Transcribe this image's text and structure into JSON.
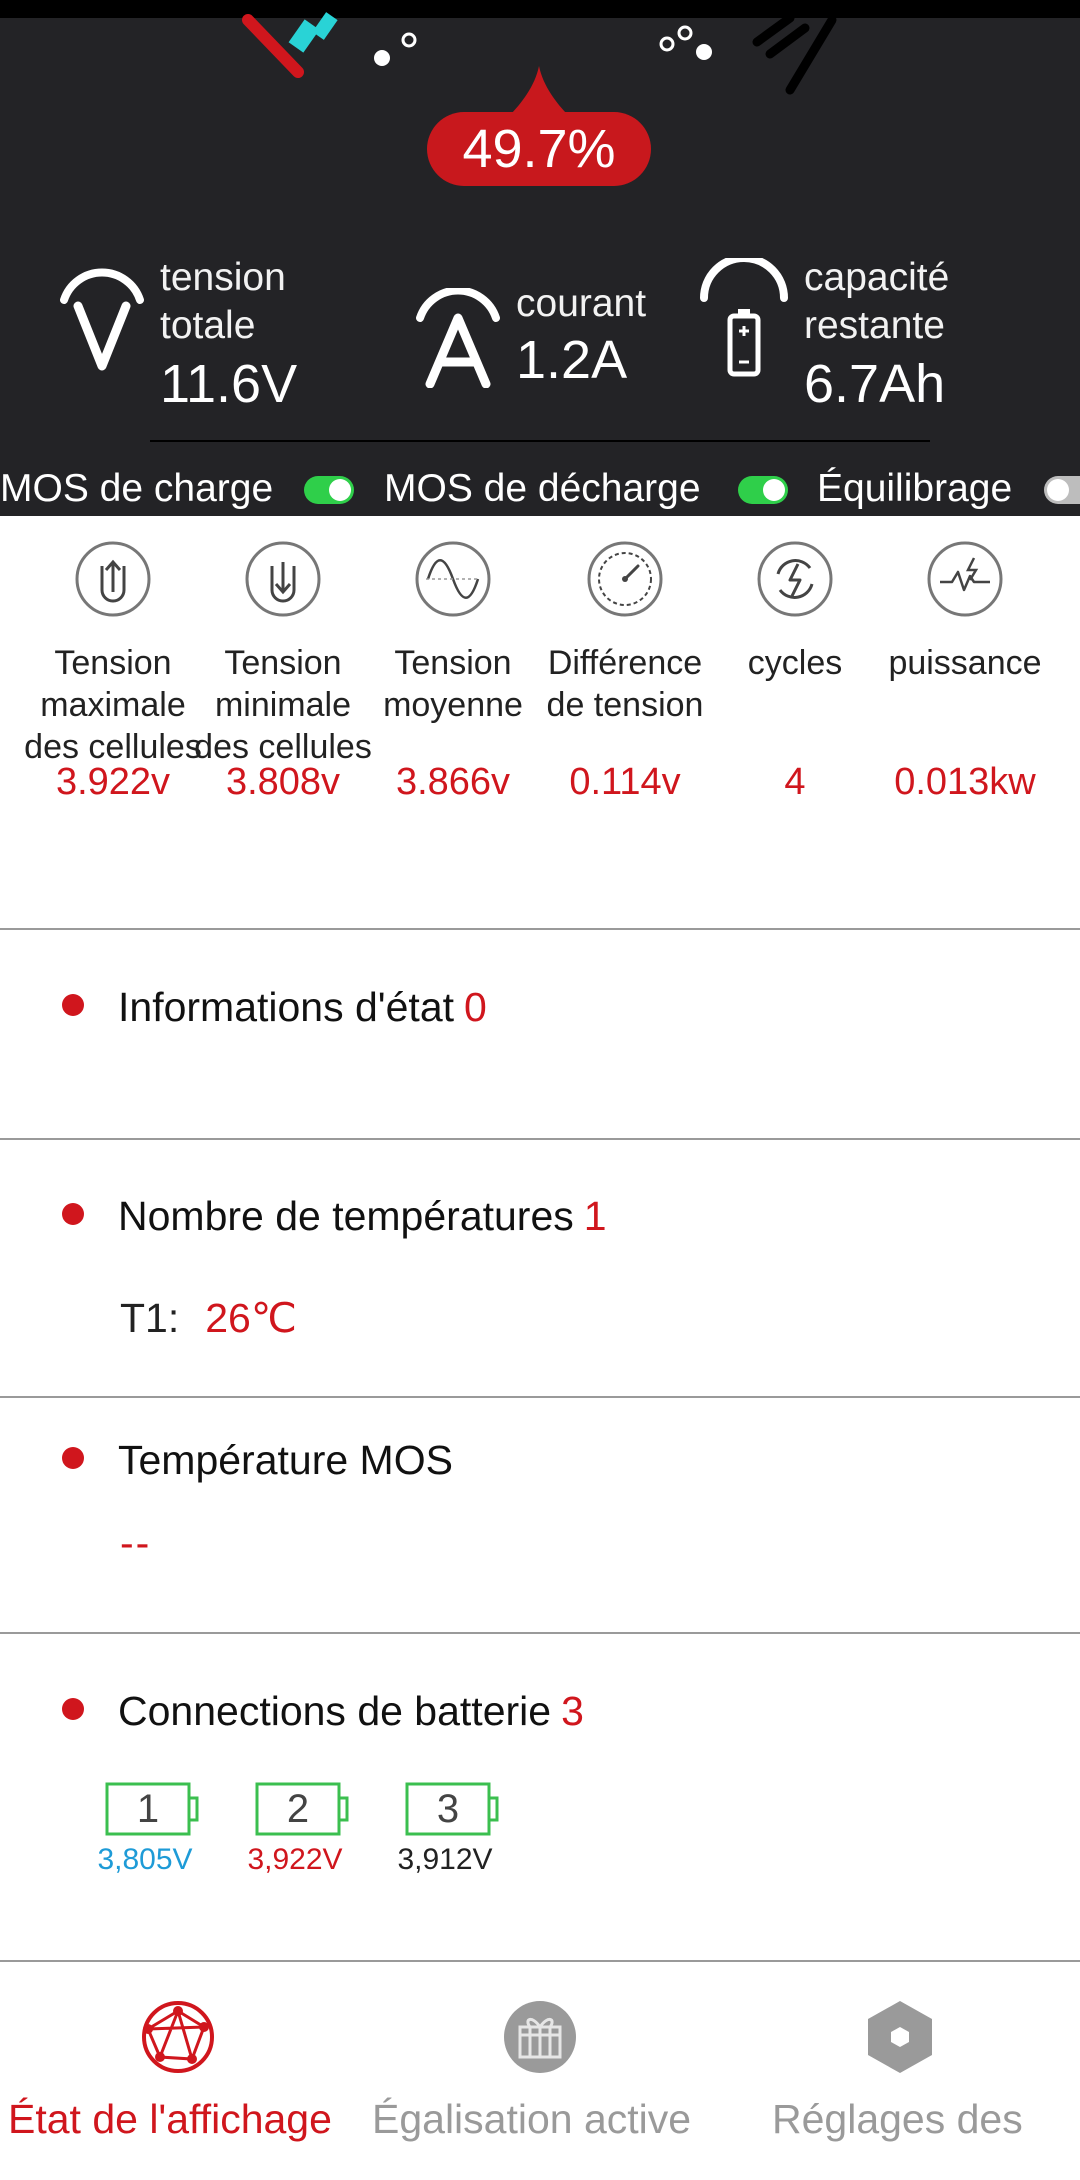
{
  "header": {
    "soc_value": "49.7%",
    "metrics": [
      {
        "label_line1": "tension",
        "label_line2": "totale",
        "value": "11.6V",
        "icon": "voltage-icon"
      },
      {
        "label_line1": "courant",
        "label_line2": "",
        "value": "1.2A",
        "icon": "current-icon"
      },
      {
        "label_line1": "capacité",
        "label_line2": "restante",
        "value": "6.7Ah",
        "icon": "battery-capacity-icon"
      }
    ],
    "switches": [
      {
        "label": "MOS de charge",
        "state": "on"
      },
      {
        "label": "MOS de décharge",
        "state": "on"
      },
      {
        "label": "Équilibrage",
        "state": "off"
      }
    ]
  },
  "stats": [
    {
      "label": "Tension maximale des cellules",
      "value": "3.922v",
      "icon": "max-voltage-icon"
    },
    {
      "label": "Tension minimale des cellules",
      "value": "3.808v",
      "icon": "min-voltage-icon"
    },
    {
      "label": "Tension moyenne",
      "value": "3.866v",
      "icon": "sine-wave-icon"
    },
    {
      "label": "Différence de tension",
      "value": "0.114v",
      "icon": "gauge-icon"
    },
    {
      "label": "cycles",
      "value": "4",
      "icon": "cycle-icon"
    },
    {
      "label": "puissance",
      "value": "0.013kw",
      "icon": "power-icon"
    }
  ],
  "status_info": {
    "label": "Informations d'état",
    "count": "0"
  },
  "temperatures": {
    "label": "Nombre de températures",
    "count": "1",
    "sensor_label": "T1:",
    "sensor_value": "26℃"
  },
  "mos_temperature": {
    "label": "Température MOS",
    "value": "--"
  },
  "battery_connections": {
    "label": "Connections de batterie",
    "count": "3",
    "cells": [
      {
        "number": "1",
        "voltage": "3,805V",
        "color": "#1e9bd7"
      },
      {
        "number": "2",
        "voltage": "3,922V",
        "color": "#d0161d"
      },
      {
        "number": "3",
        "voltage": "3,912V",
        "color": "#222222"
      }
    ]
  },
  "nav": [
    {
      "label": "État de l'affichage",
      "active": true,
      "color": "#d0161d"
    },
    {
      "label": "Égalisation active",
      "active": false,
      "color": "#9a9a9a"
    },
    {
      "label": "Réglages des",
      "active": false,
      "color": "#9a9a9a"
    }
  ],
  "colors": {
    "accent": "#d0161d",
    "dark_bg": "#232326",
    "toggle_on": "#2fcf4a"
  }
}
